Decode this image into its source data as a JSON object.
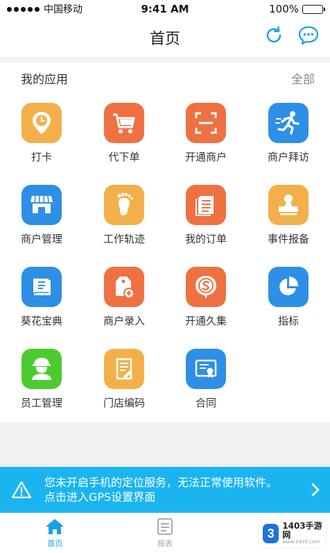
{
  "status_bar": {
    "carrier": "中国移动",
    "time": "9:41 AM",
    "battery": "100%"
  },
  "nav": {
    "title": "首页"
  },
  "apps": {
    "section_title": "我的应用",
    "all_label": "全部",
    "items": [
      {
        "label": "打卡",
        "icon": "clock-icon",
        "color": "#f3b04a"
      },
      {
        "label": "代下单",
        "icon": "cart-icon",
        "color": "#ef7142"
      },
      {
        "label": "开通商户",
        "icon": "scan-icon",
        "color": "#ef7142"
      },
      {
        "label": "商户拜访",
        "icon": "runner-icon",
        "color": "#2d8fe6"
      },
      {
        "label": "商户管理",
        "icon": "store-icon",
        "color": "#2d8fe6"
      },
      {
        "label": "工作轨迹",
        "icon": "footprint-icon",
        "color": "#f3b04a"
      },
      {
        "label": "我的订单",
        "icon": "document-icon",
        "color": "#ef7142"
      },
      {
        "label": "事件报备",
        "icon": "stamp-icon",
        "color": "#f3b04a"
      },
      {
        "label": "葵花宝典",
        "icon": "book-icon",
        "color": "#2d8fe6"
      },
      {
        "label": "商户录入",
        "icon": "tag-add-icon",
        "color": "#ef7142"
      },
      {
        "label": "开通久集",
        "icon": "s-badge-icon",
        "color": "#ef7142"
      },
      {
        "label": "指标",
        "icon": "pie-chart-icon",
        "color": "#2d8fe6"
      },
      {
        "label": "员工管理",
        "icon": "employee-icon",
        "color": "#4ccb2f"
      },
      {
        "label": "门店编码",
        "icon": "notepad-icon",
        "color": "#f3b04a"
      },
      {
        "label": "合同",
        "icon": "certificate-icon",
        "color": "#2d8fe6"
      }
    ]
  },
  "banner": {
    "line1": "您未开启手机的定位服务，无法正常使用软件。",
    "line2": "点击进入GPS设置界面",
    "icon": "warning-icon"
  },
  "tabs": [
    {
      "label": "首页",
      "icon": "home-icon",
      "active": true
    },
    {
      "label": "报表",
      "icon": "list-icon",
      "active": false
    }
  ],
  "watermark": {
    "logo": "3",
    "title": "1403手游网",
    "subtitle": "www.1403.com"
  },
  "colors": {
    "accent": "#1aa0ea",
    "banner": "#1ab4f0",
    "orange": "#ef7142",
    "yellow": "#f3b04a",
    "blue": "#2d8fe6",
    "green": "#4ccb2f"
  }
}
